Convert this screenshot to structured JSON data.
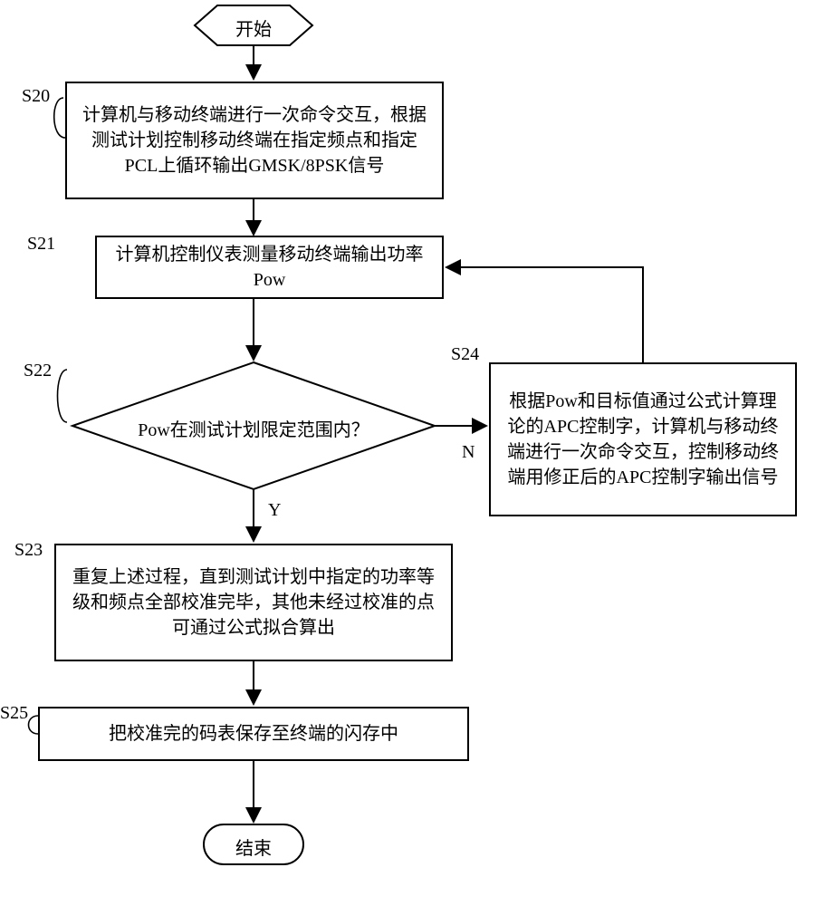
{
  "flow": {
    "start": "开始",
    "end": "结束",
    "s20_label": "S20",
    "s20": "计算机与移动终端进行一次命令交互，根据测试计划控制移动终端在指定频点和指定PCL上循环输出GMSK/8PSK信号",
    "s21_label": "S21",
    "s21": "计算机控制仪表测量移动终端输出功率Pow",
    "s22_label": "S22",
    "s22": "Pow在测试计划限定范围内？",
    "s23_label": "S23",
    "s23": "重复上述过程，直到测试计划中指定的功率等级和频点全部校准完毕，其他未经过校准的点可通过公式拟合算出",
    "s24_label": "S24",
    "s24": "根据Pow和目标值通过公式计算理论的APC控制字，计算机与移动终端进行一次命令交互，控制移动终端用修正后的APC控制字输出信号",
    "s25_label": "S25",
    "s25": "把校准完的码表保存至终端的闪存中",
    "yes": "Y",
    "no": "N"
  }
}
